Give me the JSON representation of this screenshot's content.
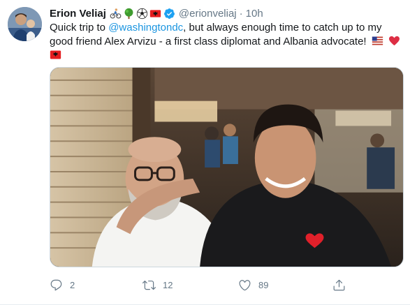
{
  "tweet": {
    "author_name": "Erion Veliaj",
    "author_emojis": [
      "cyclist-emoji",
      "tree-emoji",
      "soccer-ball-emoji",
      "albania-flag-emoji"
    ],
    "handle": "@erionveliaj",
    "separator": "·",
    "time": "10h",
    "text_before_mention": "Quick trip to ",
    "mention": "@washingtondc",
    "text_after_mention": ", but always enough time to catch up to my good friend Alex Arvizu - a first class diplomat and Albania advocate!",
    "trailing_emojis": [
      "us-flag-emoji",
      "red-heart-emoji",
      "albania-flag-emoji"
    ]
  },
  "actions": {
    "reply_count": "2",
    "retweet_count": "12",
    "like_count": "89"
  },
  "colors": {
    "link": "#1b95e0",
    "muted": "#657786",
    "verified": "#1da1f2",
    "albania_red": "#e41e20",
    "heart": "#e0245e"
  }
}
